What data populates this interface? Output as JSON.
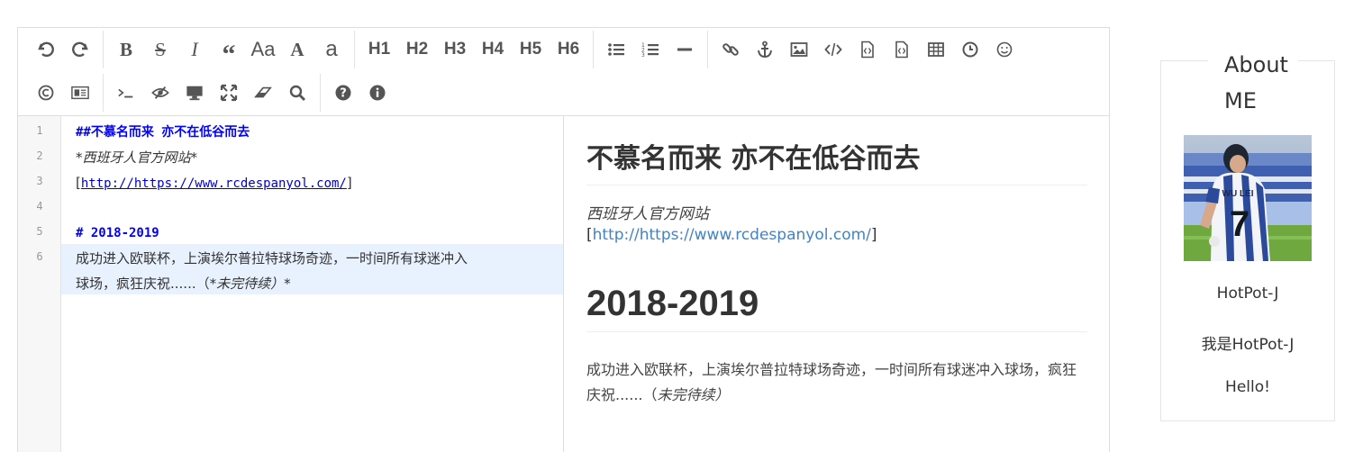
{
  "toolbar": {
    "headings": [
      "H1",
      "H2",
      "H3",
      "H4",
      "H5",
      "H6"
    ],
    "case_label": "Aa",
    "upper_label": "A",
    "lower_label": "a"
  },
  "editor": {
    "line_numbers": [
      "1",
      "2",
      "3",
      "4",
      "5",
      "6"
    ],
    "lines": [
      "##不慕名而来  亦不在低谷而去",
      "*西班牙人官方网站*",
      "",
      "",
      "# 2018-2019",
      " 成功进入欧联杯，上演埃尔普拉特球场奇迹，一时间所有球迷冲入",
      "球场，疯狂庆祝......（",
      "*未完待续）*"
    ],
    "link_open": "[",
    "link_url": "http://https://www.rcdespanyol.com/",
    "link_close": "]"
  },
  "preview": {
    "h2": "不慕名而来 亦不在低谷而去",
    "em": "西班牙人官方网站",
    "link_open": "[",
    "link_text": "http://https://www.rcdespanyol.com/",
    "link_close": "]",
    "h1": "2018-2019",
    "p": "成功进入欧联杯，上演埃尔普拉特球场奇迹，一时间所有球迷冲入球场，疯狂庆祝......（",
    "p_em": "未完待续）"
  },
  "about": {
    "title": "About ME",
    "name": "HotPot-J",
    "desc": "我是HotPot-J",
    "greeting": "Hello!",
    "avatar_jersey_name": "WU LEI",
    "avatar_jersey_number": "7"
  },
  "colors": {
    "md_heading": "#0000ff",
    "link": "#4183c4",
    "active_line": "#e8f2fe",
    "icon": "#555555"
  }
}
